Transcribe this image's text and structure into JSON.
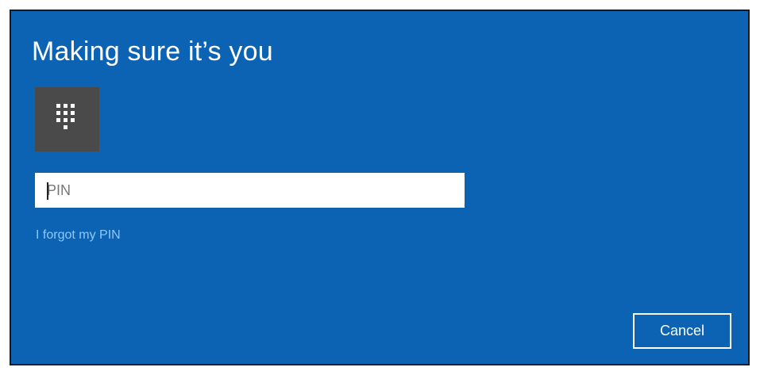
{
  "dialog": {
    "title": "Making sure it’s you",
    "pin_tile_icon": "keypad-icon",
    "pin_input": {
      "value": "",
      "placeholder": "PIN"
    },
    "forgot_link": "I forgot my PIN",
    "cancel_label": "Cancel"
  },
  "colors": {
    "background": "#0c63b4",
    "tile": "#4a4a4a",
    "link": "#8fc8f4",
    "text": "#ffffff"
  }
}
